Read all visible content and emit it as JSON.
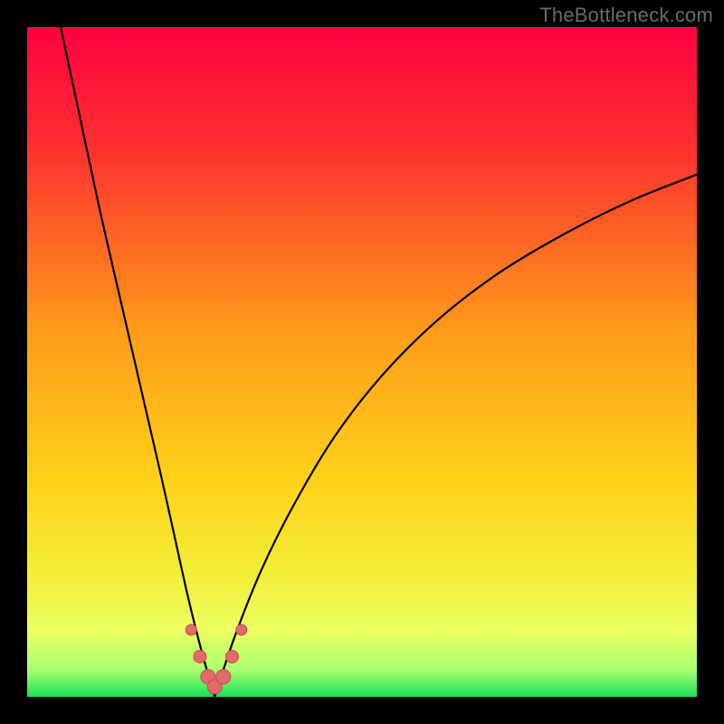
{
  "watermark": "TheBottleneck.com",
  "colors": {
    "gradient_stops": [
      {
        "offset": "0%",
        "color": "#ff0040"
      },
      {
        "offset": "18%",
        "color": "#ff3030"
      },
      {
        "offset": "45%",
        "color": "#ff9a1a"
      },
      {
        "offset": "68%",
        "color": "#ffd21a"
      },
      {
        "offset": "82%",
        "color": "#f3ef3a"
      },
      {
        "offset": "90%",
        "color": "#ecff60"
      },
      {
        "offset": "96%",
        "color": "#a8ff70"
      },
      {
        "offset": "100%",
        "color": "#18e05a"
      }
    ],
    "curve": "#000000",
    "marker_fill": "#e26a6a",
    "marker_stroke": "#c24e4e"
  },
  "chart_data": {
    "type": "line",
    "title": "",
    "xlabel": "",
    "ylabel": "",
    "xlim": [
      0,
      100
    ],
    "ylim": [
      0,
      100
    ],
    "x_optimum": 28,
    "series": [
      {
        "name": "left-branch",
        "x": [
          5,
          8,
          11,
          14,
          17,
          20,
          22,
          24,
          26,
          28
        ],
        "y": [
          100,
          86,
          72,
          59,
          46,
          33,
          24,
          15,
          7,
          0
        ]
      },
      {
        "name": "right-branch",
        "x": [
          28,
          31,
          35,
          40,
          46,
          53,
          61,
          70,
          80,
          90,
          100
        ],
        "y": [
          0,
          9,
          19,
          29,
          39,
          48,
          56,
          63,
          69,
          74,
          78
        ]
      }
    ],
    "markers": {
      "name": "near-optimum-points",
      "x": [
        24.5,
        25.8,
        27.0,
        28.0,
        29.3,
        30.6,
        32.0
      ],
      "y": [
        10.0,
        6.0,
        3.0,
        1.5,
        3.0,
        6.0,
        10.0
      ],
      "r": [
        6,
        7,
        8,
        8,
        8,
        7,
        6
      ]
    }
  }
}
